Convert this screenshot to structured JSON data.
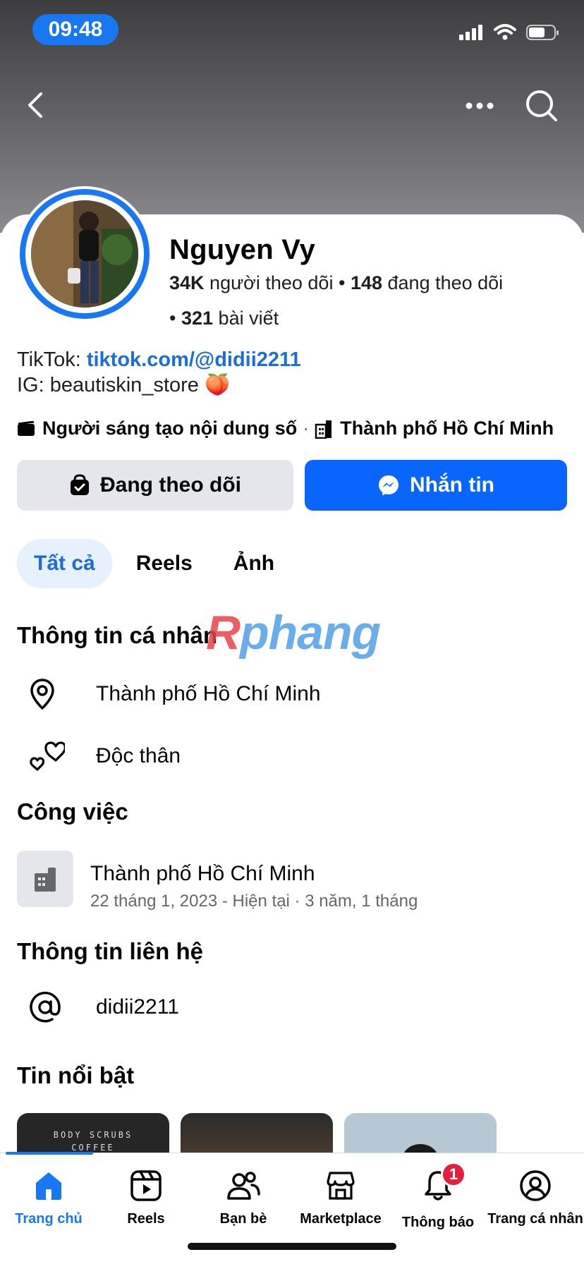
{
  "status_bar": {
    "time": "09:48"
  },
  "profile": {
    "name": "Nguyen Vy",
    "followers_count": "34K",
    "followers_label": "người theo dõi",
    "following_count": "148",
    "following_label": "đang theo dõi",
    "posts_count": "321",
    "posts_label": "bài viết"
  },
  "bio": {
    "line1_prefix": "TikTok: ",
    "line1_link": "tiktok.com/@didii2211",
    "line2": "IG: beautiskin_store 🍑"
  },
  "meta": {
    "category": "Người sáng tạo nội dung số",
    "separator": "·",
    "location": "Thành phố Hồ Chí Minh"
  },
  "actions": {
    "following_label": "Đang theo dõi",
    "message_label": "Nhắn tin"
  },
  "tabs": [
    {
      "label": "Tất cả",
      "active": true
    },
    {
      "label": "Reels",
      "active": false
    },
    {
      "label": "Ảnh",
      "active": false
    }
  ],
  "watermark": {
    "part1": "R",
    "part2": "phang"
  },
  "personal_info": {
    "title": "Thông tin cá nhân",
    "location": "Thành phố Hồ Chí Minh",
    "relationship": "Độc thân"
  },
  "work": {
    "title": "Công việc",
    "place": "Thành phố Hồ Chí Minh",
    "duration": "22 tháng 1, 2023 - Hiện tại · 3 năm, 1 tháng"
  },
  "contact": {
    "title": "Thông tin liên hệ",
    "username": "didii2211"
  },
  "featured": {
    "title": "Tin nổi bật",
    "story1_text": "BODY SCRUBS\nCOFFEE"
  },
  "bottom_nav": {
    "items": [
      {
        "label": "Trang chủ",
        "icon": "home-icon",
        "active": true
      },
      {
        "label": "Reels",
        "icon": "reels-icon",
        "active": false
      },
      {
        "label": "Bạn bè",
        "icon": "friends-icon",
        "active": false
      },
      {
        "label": "Marketplace",
        "icon": "marketplace-icon",
        "active": false
      },
      {
        "label": "Thông báo",
        "icon": "bell-icon",
        "active": false,
        "badge": "1"
      },
      {
        "label": "Trang cá nhân",
        "icon": "profile-icon",
        "active": false
      }
    ]
  },
  "colors": {
    "accent": "#1877f2",
    "message_button": "#0866ff",
    "secondary_button": "#e4e6eb",
    "badge": "#e41e3f"
  }
}
